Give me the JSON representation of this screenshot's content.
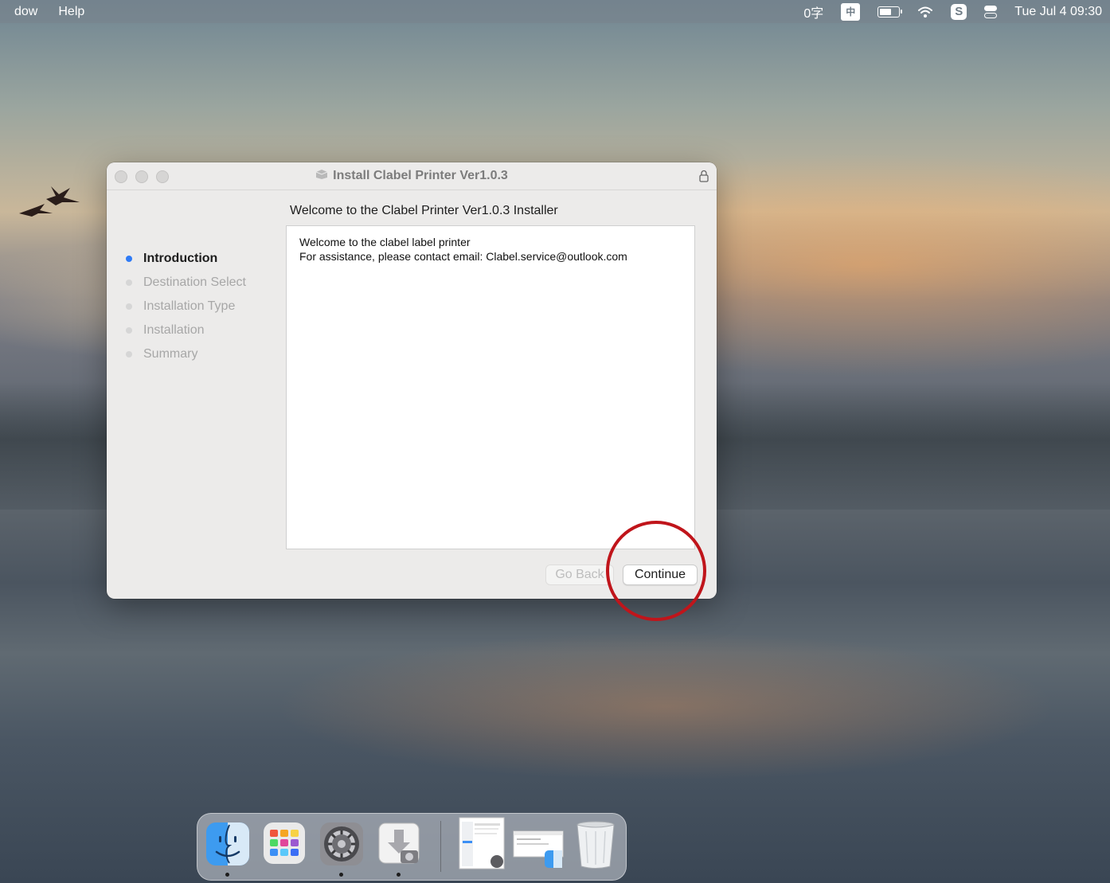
{
  "menubar": {
    "app_menu_partial": "dow",
    "help": "Help",
    "input_method": "0字",
    "ime_badge": "中",
    "sogou_badge": "S",
    "date": "Tue Jul 4",
    "time": "09:30",
    "icons": [
      "input-method-icon",
      "battery-icon",
      "wifi-icon",
      "sogou-icon",
      "control-center-icon"
    ]
  },
  "window": {
    "title": "Install Clabel Printer Ver1.0.3",
    "heading": "Welcome to the Clabel Printer Ver1.0.3 Installer",
    "steps": [
      {
        "label": "Introduction",
        "active": true
      },
      {
        "label": "Destination Select",
        "active": false
      },
      {
        "label": "Installation Type",
        "active": false
      },
      {
        "label": "Installation",
        "active": false
      },
      {
        "label": "Summary",
        "active": false
      }
    ],
    "content_lines": [
      "Welcome to the clabel label printer",
      "For assistance, please contact email: Clabel.service@outlook.com"
    ],
    "go_back_label": "Go Back",
    "continue_label": "Continue"
  },
  "dock": {
    "items": [
      "finder-icon",
      "launchpad-icon",
      "system-preferences-icon",
      "installer-icon",
      "preview-window-icon",
      "finder-window-icon",
      "trash-icon"
    ]
  },
  "colors": {
    "accent": "#2f7bf6",
    "highlight": "#c0151b"
  }
}
